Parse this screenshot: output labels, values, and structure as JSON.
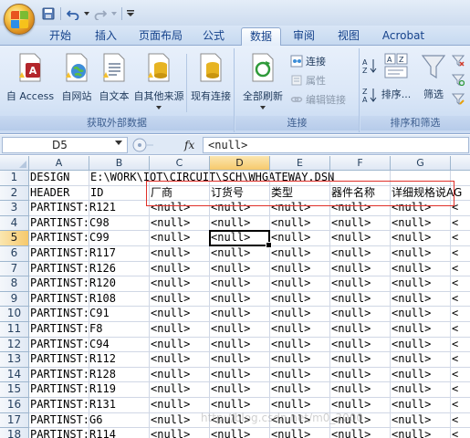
{
  "quick_access": {
    "items": [
      {
        "name": "save-icon"
      },
      {
        "name": "undo-icon"
      },
      {
        "name": "undo-dropdown-icon"
      },
      {
        "name": "redo-icon"
      },
      {
        "name": "redo-dropdown-icon"
      },
      {
        "name": "customize-qat-icon"
      }
    ]
  },
  "tabs": [
    {
      "label": "开始",
      "active": false
    },
    {
      "label": "插入",
      "active": false
    },
    {
      "label": "页面布局",
      "active": false
    },
    {
      "label": "公式",
      "active": false
    },
    {
      "label": "数据",
      "active": true
    },
    {
      "label": "审阅",
      "active": false
    },
    {
      "label": "视图",
      "active": false
    },
    {
      "label": "Acrobat",
      "active": false
    }
  ],
  "ribbon": {
    "get_external": {
      "label": "获取外部数据",
      "buttons": [
        "自 Access",
        "自网站",
        "自文本",
        "自其他来源"
      ],
      "existing": "现有连接"
    },
    "connections": {
      "label": "连接",
      "refresh_all": "全部刷新",
      "connections": "连接",
      "properties": "属性",
      "edit_links": "编辑链接"
    },
    "sort_filter": {
      "label": "排序和筛选",
      "sort": "排序...",
      "filter": "筛选"
    }
  },
  "formula_bar": {
    "name_box": "D5",
    "formula": "<null>",
    "fx": "fx"
  },
  "grid": {
    "columns": [
      "A",
      "B",
      "C",
      "D",
      "E",
      "F",
      "G"
    ],
    "selected_column": "D",
    "selected_row": "5",
    "rows": [
      {
        "n": "1",
        "cells": [
          "DESIGN",
          "E:\\WORK\\IOT\\CIRCUIT\\SCH\\WHGATEWAY.DSN",
          "",
          "",
          "",
          "",
          ""
        ]
      },
      {
        "n": "2",
        "cells": [
          "HEADER",
          "ID",
          "厂商",
          "订货号",
          "类型",
          "器件名称",
          "详细规格说AG"
        ]
      },
      {
        "n": "3",
        "cells": [
          "PARTINST:R121",
          "",
          "<null>",
          "<null>",
          "<null>",
          "<null>",
          "<null>"
        ]
      },
      {
        "n": "4",
        "cells": [
          "PARTINST:C98",
          "",
          "<null>",
          "<null>",
          "<null>",
          "<null>",
          "<null>"
        ]
      },
      {
        "n": "5",
        "cells": [
          "PARTINST:C99",
          "",
          "<null>",
          "<null>",
          "<null>",
          "<null>",
          "<null>"
        ]
      },
      {
        "n": "6",
        "cells": [
          "PARTINST:R117",
          "",
          "<null>",
          "<null>",
          "<null>",
          "<null>",
          "<null>"
        ]
      },
      {
        "n": "7",
        "cells": [
          "PARTINST:R126",
          "",
          "<null>",
          "<null>",
          "<null>",
          "<null>",
          "<null>"
        ]
      },
      {
        "n": "8",
        "cells": [
          "PARTINST:R120",
          "",
          "<null>",
          "<null>",
          "<null>",
          "<null>",
          "<null>"
        ]
      },
      {
        "n": "9",
        "cells": [
          "PARTINST:R108",
          "",
          "<null>",
          "<null>",
          "<null>",
          "<null>",
          "<null>"
        ]
      },
      {
        "n": "10",
        "cells": [
          "PARTINST:C91",
          "",
          "<null>",
          "<null>",
          "<null>",
          "<null>",
          "<null>"
        ]
      },
      {
        "n": "11",
        "cells": [
          "PARTINST:F8",
          "",
          "<null>",
          "<null>",
          "<null>",
          "<null>",
          "<null>"
        ]
      },
      {
        "n": "12",
        "cells": [
          "PARTINST:C94",
          "",
          "<null>",
          "<null>",
          "<null>",
          "<null>",
          "<null>"
        ]
      },
      {
        "n": "13",
        "cells": [
          "PARTINST:R112",
          "",
          "<null>",
          "<null>",
          "<null>",
          "<null>",
          "<null>"
        ]
      },
      {
        "n": "14",
        "cells": [
          "PARTINST:R128",
          "",
          "<null>",
          "<null>",
          "<null>",
          "<null>",
          "<null>"
        ]
      },
      {
        "n": "15",
        "cells": [
          "PARTINST:R119",
          "",
          "<null>",
          "<null>",
          "<null>",
          "<null>",
          "<null>"
        ]
      },
      {
        "n": "16",
        "cells": [
          "PARTINST:R131",
          "",
          "<null>",
          "<null>",
          "<null>",
          "<null>",
          "<null>"
        ]
      },
      {
        "n": "17",
        "cells": [
          "PARTINST:G6",
          "",
          "<null>",
          "<null>",
          "<null>",
          "<null>",
          "<null>"
        ]
      },
      {
        "n": "18",
        "cells": [
          "PARTINST:R114",
          "",
          "<null>",
          "<null>",
          "<null>",
          "<null>",
          "<null>"
        ]
      }
    ]
  },
  "watermark": "http://blog.csdn.net/m0_3000",
  "colors": {
    "highlight_box": "#e0302a",
    "selected_header": "#f6c96c",
    "ribbon_text": "#15428b"
  }
}
